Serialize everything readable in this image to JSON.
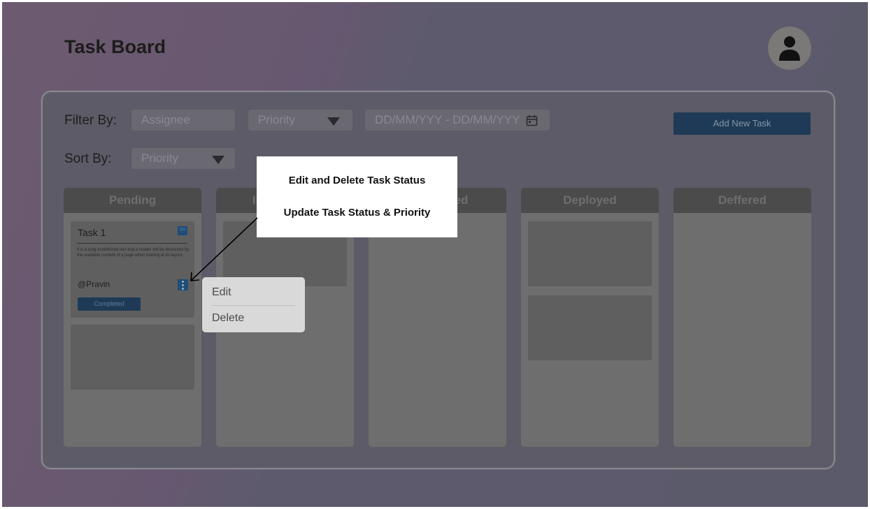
{
  "header": {
    "title": "Task Board",
    "avatar_icon": "user-icon"
  },
  "filters": {
    "filter_label": "Filter By:",
    "assignee_placeholder": "Assignee",
    "priority_value": "Priority",
    "date_range": "DD/MM/YYY - DD/MM/YYY",
    "sort_label": "Sort By:",
    "sort_value": "Priority",
    "add_button": "Add New Task"
  },
  "columns": [
    {
      "label": "Pending"
    },
    {
      "label": "In Progress"
    },
    {
      "label": "Completed"
    },
    {
      "label": "Deployed"
    },
    {
      "label": "Deffered"
    }
  ],
  "task": {
    "title": "Task 1",
    "priority": "P0",
    "description": "It is a long established fact that a reader will be distracted by the readable content of a page when looking at its layout.",
    "assignee": "@Pravin",
    "status": "Completed"
  },
  "context_menu": {
    "edit": "Edit",
    "delete": "Delete"
  },
  "callout": {
    "line1": "Edit and Delete Task Status",
    "line2": "Update Task Status & Priority"
  },
  "colors": {
    "accent": "#1e3a56",
    "overlay": "#5c5b67",
    "column_header": "#4b4b4b"
  }
}
